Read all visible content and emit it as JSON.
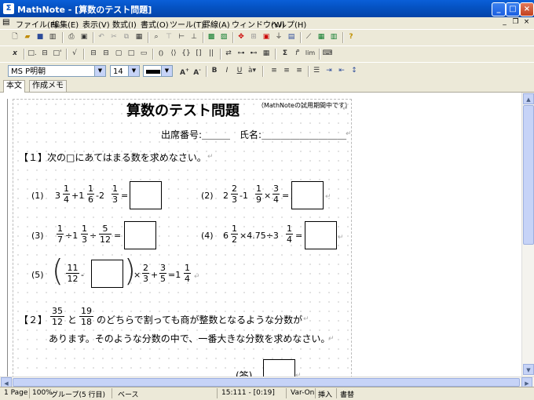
{
  "window": {
    "title": "MathNote - [算数のテスト問題]"
  },
  "menu": [
    "ファイル(F)",
    "編集(E)",
    "表示(V)",
    "数式(I)",
    "書式(O)",
    "ツール(T)",
    "罫線(A)",
    "ウィンドウ(W)",
    "ヘルプ(H)"
  ],
  "format_bar": {
    "font_name": "MS P明朝",
    "font_size": "14"
  },
  "tabs": [
    "本文",
    "作成メモ"
  ],
  "document": {
    "title": "算数のテスト問題",
    "trial_note": "（MathNoteの試用期間中です）",
    "header_line": "出席番号:＿＿＿　氏名:＿＿＿＿＿＿＿＿＿",
    "q1_heading": "【１】次の□にあてはまる数を求めなさい。",
    "p1": {
      "label": "(1)",
      "w1": "3",
      "f1": [
        "1",
        "4"
      ],
      "op1": "+1",
      "f2": [
        "1",
        "6"
      ],
      "op2": "-2",
      "f3": [
        "1",
        "3"
      ],
      "eq": "="
    },
    "p2": {
      "label": "(2)",
      "w1": "2",
      "f1": [
        "2",
        "3"
      ],
      "op1": "-1",
      "f2": [
        "1",
        "9"
      ],
      "op2": "×",
      "f3": [
        "3",
        "4"
      ],
      "eq": "="
    },
    "p3": {
      "label": "(3)",
      "f1": [
        "1",
        "7"
      ],
      "op1": "÷1",
      "f2": [
        "1",
        "3"
      ],
      "op2": "÷",
      "f3": [
        "5",
        "12"
      ],
      "eq": "="
    },
    "p4": {
      "label": "(4)",
      "w1": "6",
      "f1": [
        "1",
        "2"
      ],
      "op1": "×4.75÷3",
      "f2": [
        "1",
        "4"
      ],
      "eq": "="
    },
    "p5": {
      "label": "(5)",
      "f1": [
        "11",
        "12"
      ],
      "minus": "-",
      "times": "×",
      "f2": [
        "2",
        "3"
      ],
      "plus": "+",
      "f3": [
        "3",
        "5"
      ],
      "eq": "=1",
      "f4": [
        "1",
        "4"
      ]
    },
    "q2_heading": "【２】",
    "q2_f1": [
      "35",
      "12"
    ],
    "q2_and": "と",
    "q2_f2": [
      "19",
      "18"
    ],
    "q2_text1": "のどちらで割っても商が整数となるような分数が",
    "q2_text2": "あります。そのような分数の中で、一番大きな分数を求めなさい。",
    "answer_label": "(答)"
  },
  "status": [
    "1 Page",
    "100%",
    "グループ(5 行目)",
    "ベース",
    "15:111 - [0:19]",
    "Var-On",
    "挿入",
    "書替"
  ]
}
